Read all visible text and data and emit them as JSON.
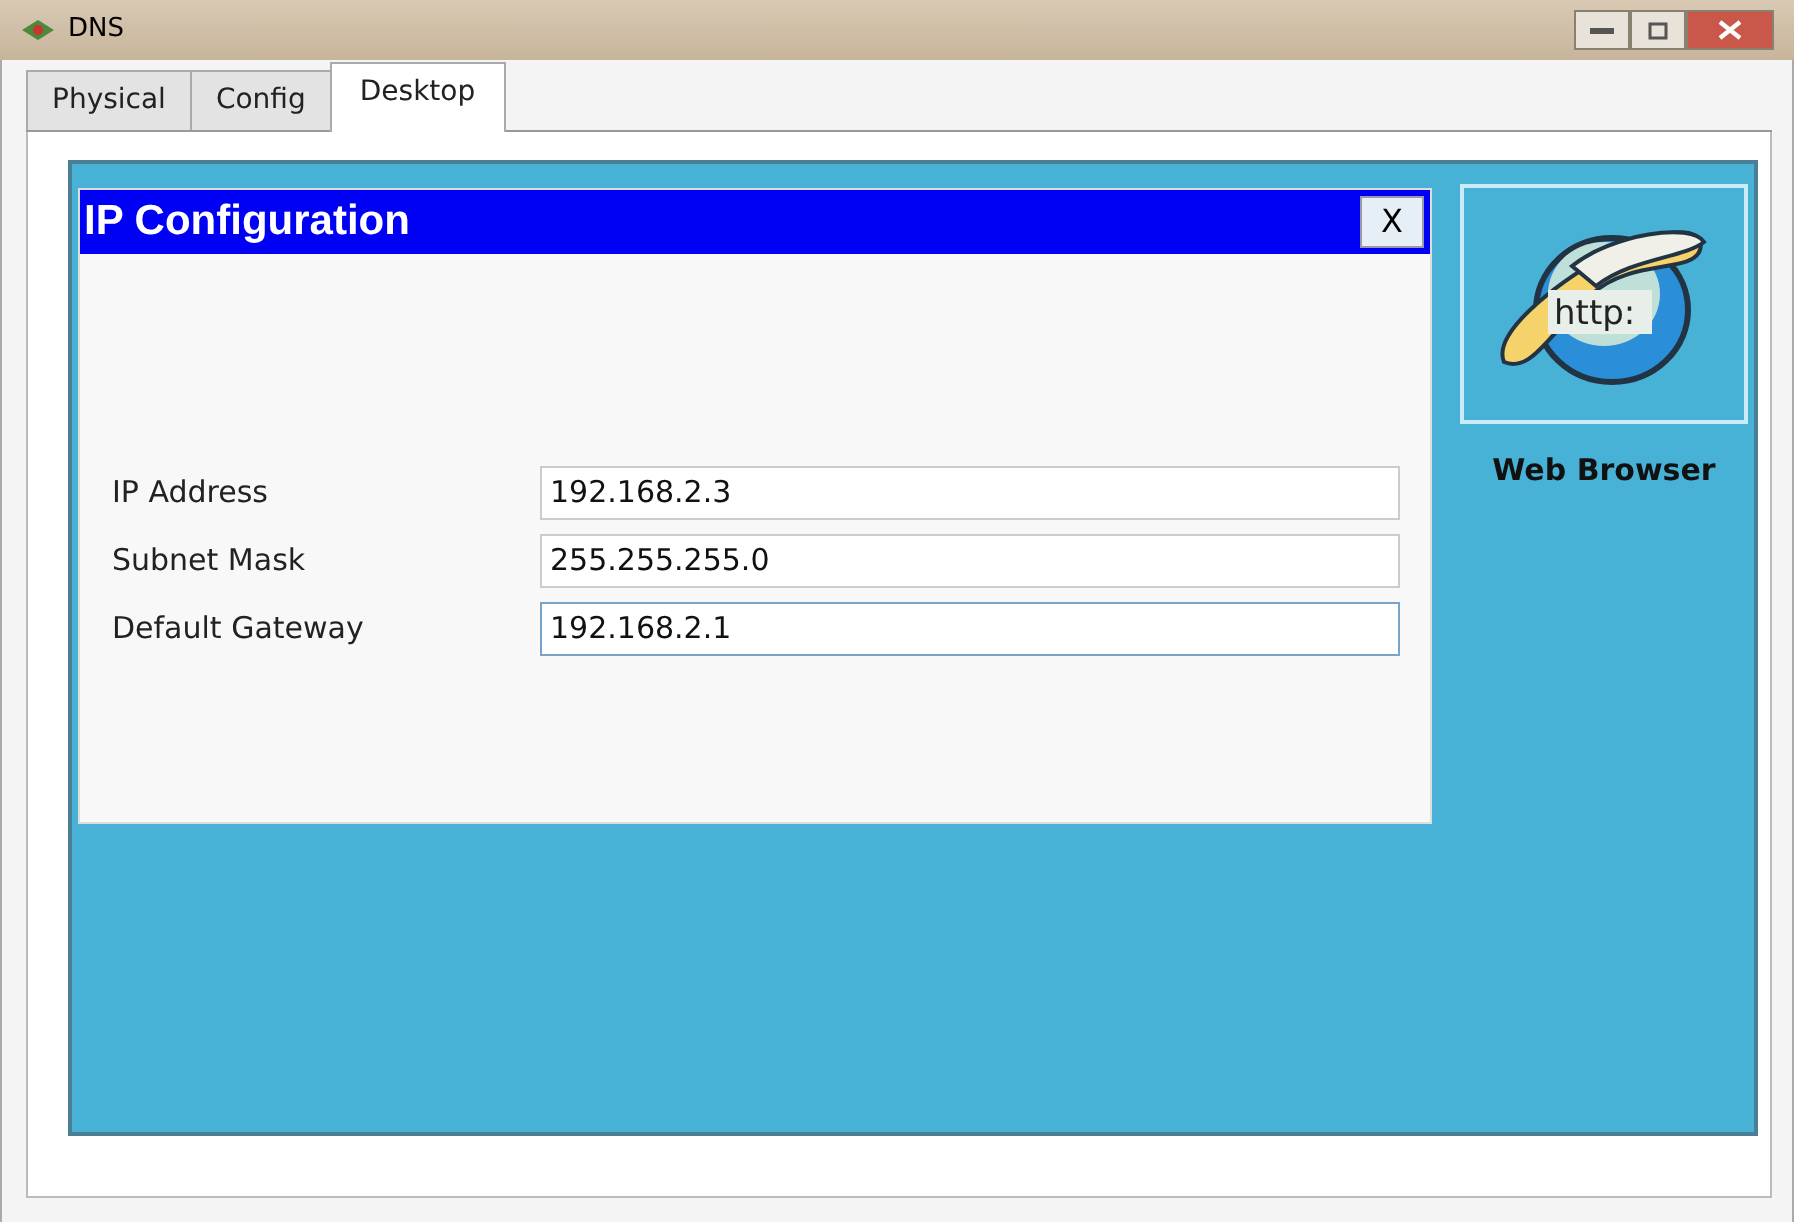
{
  "window": {
    "title": "DNS"
  },
  "tabs": [
    {
      "label": "Physical",
      "selected": false
    },
    {
      "label": "Config",
      "selected": false
    },
    {
      "label": "Desktop",
      "selected": true
    }
  ],
  "dialog": {
    "title": "IP Configuration",
    "close": "X",
    "fields": [
      {
        "label": "IP Address",
        "value": "192.168.2.3",
        "focused": false
      },
      {
        "label": "Subnet Mask",
        "value": "255.255.255.0",
        "focused": false
      },
      {
        "label": "Default Gateway",
        "value": "192.168.2.1",
        "focused": true
      }
    ]
  },
  "desktop_apps": [
    {
      "label": "Web Browser",
      "icon_text": "http:"
    }
  ]
}
